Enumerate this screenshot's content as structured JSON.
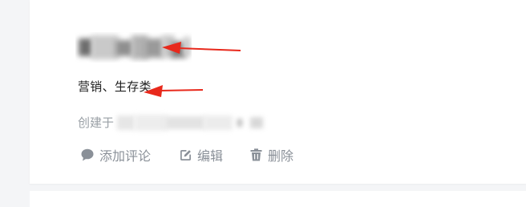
{
  "card": {
    "tags_text": "营销、生存类",
    "created_label": "创建于",
    "actions": {
      "comment_label": "添加评论",
      "edit_label": "编辑",
      "delete_label": "删除"
    }
  },
  "colors": {
    "text_primary": "#1f1f1f",
    "text_muted": "#9aa0a6",
    "action_gray": "#8a9098",
    "annotation_arrow": "#e8291c"
  },
  "icons": {
    "comment": "speech-bubble-icon",
    "edit": "edit-square-icon",
    "delete": "trash-icon"
  }
}
